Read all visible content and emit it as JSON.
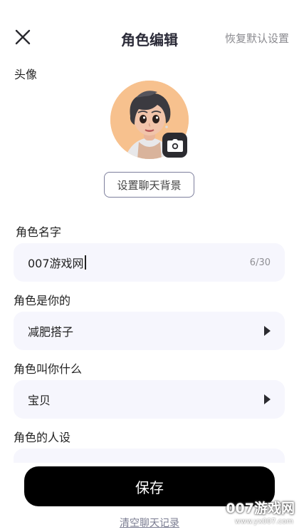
{
  "header": {
    "title": "角色编辑",
    "restore_label": "恢复默认设置"
  },
  "avatar_section": {
    "label": "头像",
    "background_button": "设置聊天背景"
  },
  "name_field": {
    "label": "角色名字",
    "value": "007游戏网",
    "counter": "6/30"
  },
  "role_field": {
    "label": "角色是你的",
    "value": "减肥搭子"
  },
  "call_field": {
    "label": "角色叫你什么",
    "value": "宝贝"
  },
  "persona_field": {
    "label": "角色的人设"
  },
  "actions": {
    "save_label": "保存",
    "clear_label": "清空聊天记录"
  },
  "watermark": {
    "text": "007游戏网",
    "url": "www.yx007.com"
  },
  "colors": {
    "field_bg": "#f6f6fd",
    "save_bg": "#000000",
    "accent_border": "#7d7f9c"
  },
  "icons": [
    "close-icon",
    "camera-icon",
    "triangle-right-icon"
  ]
}
